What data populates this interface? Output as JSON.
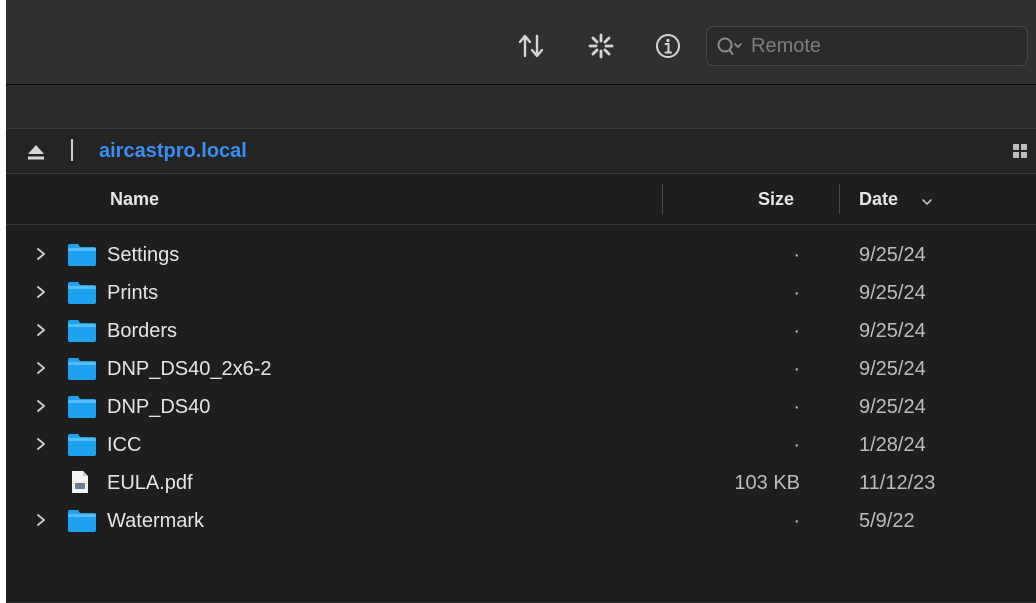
{
  "search": {
    "placeholder": "Remote",
    "value": ""
  },
  "toolbar": {
    "icons": [
      "sort-arrows-icon",
      "activity-spinner-icon",
      "info-icon"
    ]
  },
  "path": {
    "label": "aircastpro.local"
  },
  "columns": {
    "name": "Name",
    "size": "Size",
    "date": "Date",
    "sort_indicator": "chevron-down-icon"
  },
  "files": [
    {
      "name": "Settings",
      "size": "·",
      "date": "9/25/24",
      "kind": "folder"
    },
    {
      "name": "Prints",
      "size": "·",
      "date": "9/25/24",
      "kind": "folder"
    },
    {
      "name": "Borders",
      "size": "·",
      "date": "9/25/24",
      "kind": "folder"
    },
    {
      "name": "DNP_DS40_2x6-2",
      "size": "·",
      "date": "9/25/24",
      "kind": "folder"
    },
    {
      "name": "DNP_DS40",
      "size": "·",
      "date": "9/25/24",
      "kind": "folder"
    },
    {
      "name": "ICC",
      "size": "·",
      "date": "1/28/24",
      "kind": "folder"
    },
    {
      "name": "EULA.pdf",
      "size": "103 KB",
      "date": "11/12/23",
      "kind": "pdf"
    },
    {
      "name": "Watermark",
      "size": "·",
      "date": "5/9/22",
      "kind": "folder"
    }
  ],
  "colors": {
    "folder": "#1ea1ef",
    "folder_tab": "#54bdf7",
    "path_link": "#3a8ef6",
    "background": "#1e1e1e",
    "toolbar": "#303030"
  }
}
